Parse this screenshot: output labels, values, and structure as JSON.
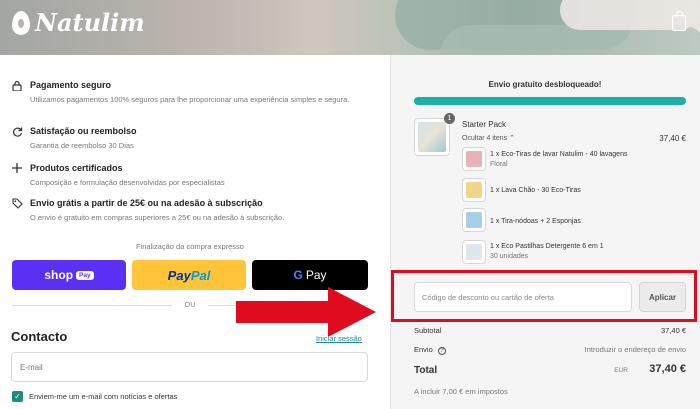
{
  "header": {
    "brand": "Natulim"
  },
  "features": [
    {
      "icon": "lock-icon",
      "title": "Pagamento seguro",
      "desc": "Utilizamos pagamentos 100% seguros para lhe proporcionar uma experiência simples e segura."
    },
    {
      "icon": "refresh-icon",
      "title": "Satisfação ou reembolso",
      "desc": "Garantia de reembolso 30 Dias"
    },
    {
      "icon": "plus-icon",
      "title": "Produtos certificados",
      "desc": "Composição e formulação desenvolvidas por especialistas"
    },
    {
      "icon": "tag-icon",
      "title": "Envio grátis a partir de 25€ ou na adesão à subscrição",
      "desc": "O envio é gratuito em compras superiores a 25€ ou na adesão à subscrição."
    }
  ],
  "express": {
    "label": "Finalização da compra expresso",
    "shop": "shop",
    "shop_pay": "Pay",
    "paypal_a": "Pay",
    "paypal_b": "Pal",
    "gpay_g": "G",
    "gpay": "Pay",
    "or": "OU"
  },
  "contact": {
    "title": "Contacto",
    "login": "Iniciar sessão",
    "email_placeholder": "E-mail",
    "newsletter": "Enviem-me um e-mail com notícias e ofertas"
  },
  "summary": {
    "free_shipping": "Envio gratuito desbloqueado!",
    "progress": 1.0,
    "product": {
      "qty": "1",
      "name": "Starter Pack",
      "toggle": "Ocultar 4 itens",
      "price": "37,40 €",
      "items": [
        {
          "name": "1 x Eco-Tiras de lavar Natulim - 40 lavagens",
          "variant": "Floral"
        },
        {
          "name": "1 x Lava Chão - 30 Eco-Tiras",
          "variant": ""
        },
        {
          "name": "1 x Tira-nódoas + 2 Esponjas",
          "variant": ""
        },
        {
          "name": "1 x Eco Pastilhas Detergente 6 em 1",
          "variant": "30 unidades"
        }
      ]
    },
    "discount_placeholder": "Código de desconto ou cartão de oferta",
    "apply": "Aplicar",
    "subtotal_label": "Subtotal",
    "subtotal": "37,40 €",
    "shipping_label": "Envio",
    "shipping": "Introduzir o endereço de envio",
    "total_label": "Total",
    "currency": "EUR",
    "total": "37,40 €",
    "tax": "A incluir 7,00 € em impostos"
  },
  "colors": {
    "accent": "#1fb0a5",
    "highlight": "#e00b1e",
    "shop": "#5a31f4",
    "paypal": "#ffc439"
  }
}
